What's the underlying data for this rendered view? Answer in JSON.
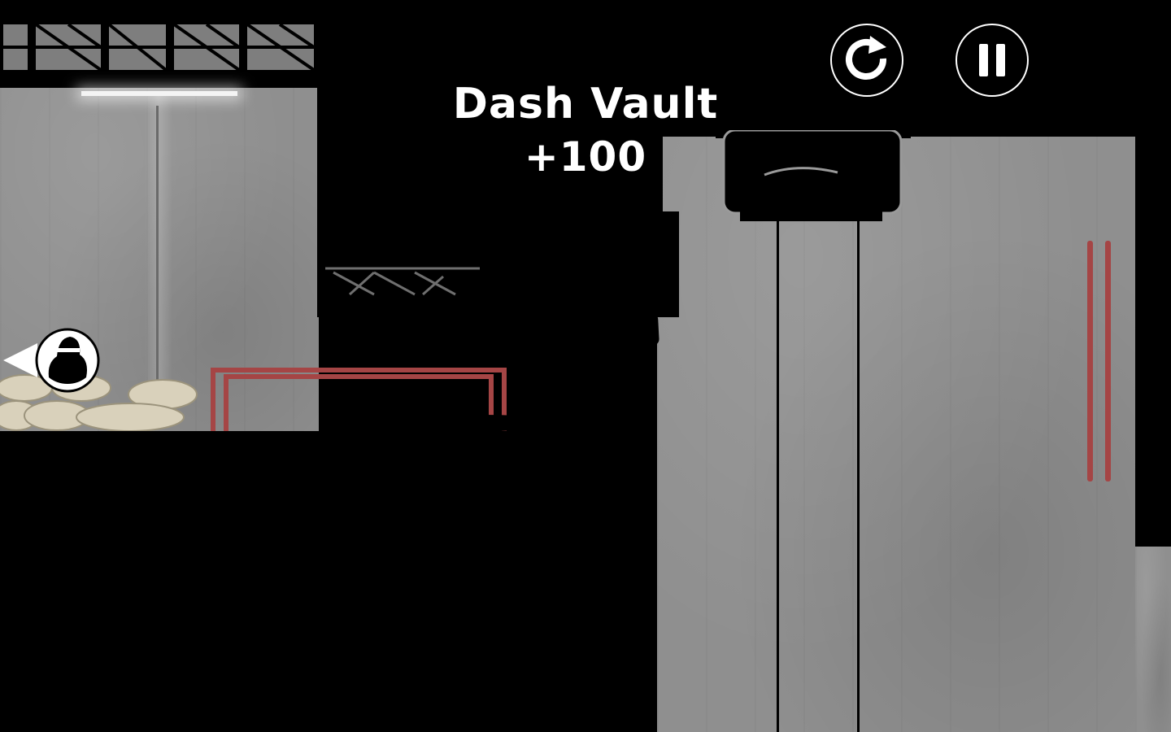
{
  "hud": {
    "restart_icon": "restart-icon",
    "pause_icon": "pause-icon"
  },
  "toast": {
    "trick_name": "Dash Vault",
    "score_bonus": "+100"
  },
  "offscreen_indicator": {
    "icon": "chaser-head-icon",
    "direction": "left"
  },
  "colors": {
    "background": "#000000",
    "wall": "#8f8f8f",
    "pipe": "#a54545",
    "sandbag": "#d9d1bb",
    "hud_outline": "#ffffff"
  }
}
